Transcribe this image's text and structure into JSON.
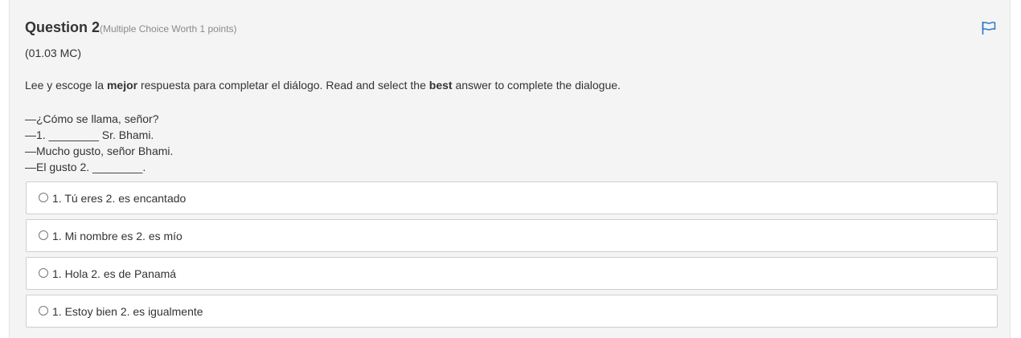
{
  "question": {
    "title": "Question 2",
    "meta": "(Multiple Choice Worth 1 points)",
    "code": "(01.03 MC)",
    "prompt": {
      "p1": "Lee y escoge la ",
      "b1": "mejor",
      "p2": " respuesta para completar el diálogo. Read and select the ",
      "b2": "best",
      "p3": " answer to complete the dialogue."
    },
    "dialogue": [
      "—¿Cómo se llama, señor?",
      "—1. ________ Sr. Bhami.",
      "—Mucho gusto, señor Bhami.",
      "—El gusto 2. ________."
    ]
  },
  "options": [
    {
      "label": "1. Tú eres 2. es encantado",
      "selected": false
    },
    {
      "label": "1. Mi nombre es 2. es mío",
      "selected": false
    },
    {
      "label": "1. Hola 2. es de Panamá",
      "selected": false
    },
    {
      "label": "1. Estoy bien 2. es igualmente",
      "selected": false
    }
  ],
  "icons": {
    "flag": "flag-icon"
  },
  "colors": {
    "flag": "#2a79c8",
    "panel_bg": "#f4f4f4",
    "option_border": "#cfcfcf"
  }
}
